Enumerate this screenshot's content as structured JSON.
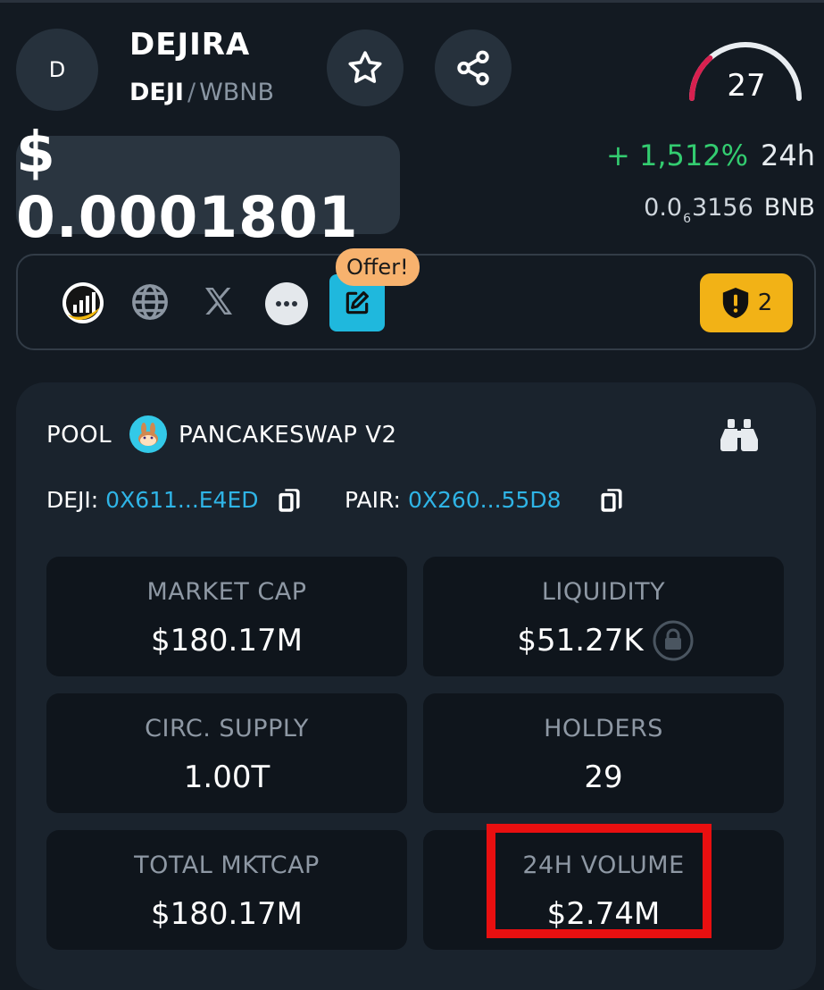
{
  "token": {
    "avatar_letter": "D",
    "name": "DEJIRA",
    "symbol": "DEJI",
    "separator": "/",
    "quote": "WBNB"
  },
  "header_buttons": {
    "favorite_icon": "star-icon",
    "share_icon": "share-icon"
  },
  "score": {
    "value": "27",
    "fraction": 0.27,
    "arc_color": "#d8204f"
  },
  "price": {
    "usd": "$ 0.0001801",
    "change_pct": "+ 1,512%",
    "change_period": "24h",
    "bnb_lead": "0.0",
    "bnb_zero_count": "6",
    "bnb_tail": "3156",
    "bnb_unit": "BNB"
  },
  "links": {
    "icons": [
      "chart-logo-icon",
      "globe-icon",
      "x-icon",
      "more-icon",
      "edit-icon"
    ],
    "offer_label": "Offer!",
    "warning_count": "2"
  },
  "pool": {
    "label": "POOL",
    "dex_name": "PANCAKESWAP V2",
    "token_label": "DEJI:",
    "token_address": "0X611...E4ED",
    "pair_label": "PAIR:",
    "pair_address": "0X260...55D8"
  },
  "stats": [
    {
      "title": "MARKET CAP",
      "value": "$180.17M"
    },
    {
      "title": "LIQUIDITY",
      "value": "$51.27K"
    },
    {
      "title": "CIRC. SUPPLY",
      "value": "1.00T"
    },
    {
      "title": "HOLDERS",
      "value": "29"
    },
    {
      "title": "TOTAL MKTCAP",
      "value": "$180.17M"
    },
    {
      "title": "24H VOLUME",
      "value": "$2.74M"
    }
  ],
  "colors": {
    "background": "#131a22",
    "positive": "#33cc70",
    "link": "#2fb4e6",
    "warning": "#f2b216",
    "offer": "#f7b26e",
    "highlight": "#e80f10"
  }
}
